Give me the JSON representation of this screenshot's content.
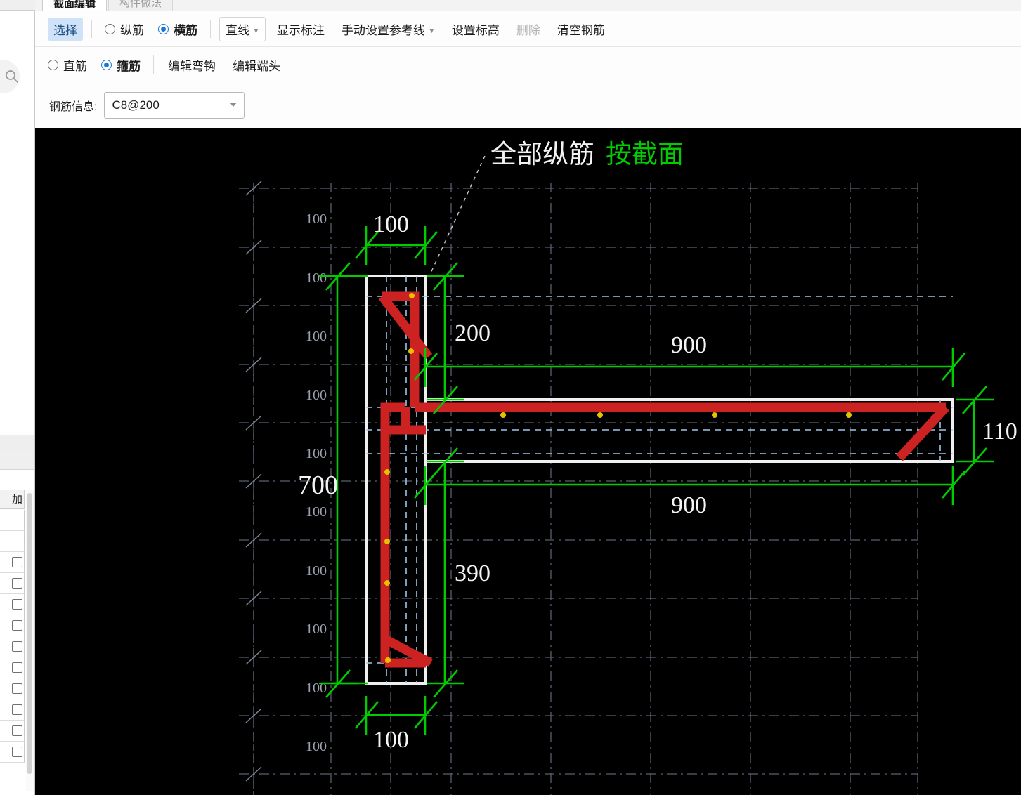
{
  "tabs": [
    {
      "label": "截面编辑",
      "active": true
    },
    {
      "label": "构件做法",
      "active": false
    }
  ],
  "toolbar": {
    "row1": {
      "select_label": "选择",
      "radio_vertical": "纵筋",
      "radio_horizontal": "横筋",
      "line_label": "直线",
      "show_dim_label": "显示标注",
      "manual_ref_label": "手动设置参考线",
      "set_elev_label": "设置标高",
      "delete_label": "删除",
      "clear_rebar_label": "清空钢筋"
    },
    "row2": {
      "radio_straight": "直筋",
      "radio_stirrup": "箍筋",
      "edit_hook_label": "编辑弯钩",
      "edit_end_label": "编辑端头"
    }
  },
  "rebar_info": {
    "label": "钢筋信息:",
    "value": "C8@200"
  },
  "canvas": {
    "annotation_all_longitudinal": "全部纵筋",
    "annotation_by_section": "按截面",
    "accent_green": "#00cc00",
    "rebar_red": "#cc2222",
    "section_white": "#f0f0f0",
    "node_yellow": "#e8c000",
    "dim_labels": {
      "top_width": "100",
      "left_column_200": "200",
      "flange_top_900": "900",
      "flange_bottom_900": "900",
      "right_thickness_110": "110",
      "total_height_700": "700",
      "web_390": "390",
      "bottom_width": "100"
    },
    "axis_ticks_left": [
      "100",
      "100",
      "100",
      "100",
      "100",
      "100",
      "100",
      "100",
      "100"
    ],
    "total_height_label": "700"
  },
  "left_panel": {
    "column_header": "加",
    "row_count": 12
  },
  "icons": {
    "search": "search-icon"
  }
}
